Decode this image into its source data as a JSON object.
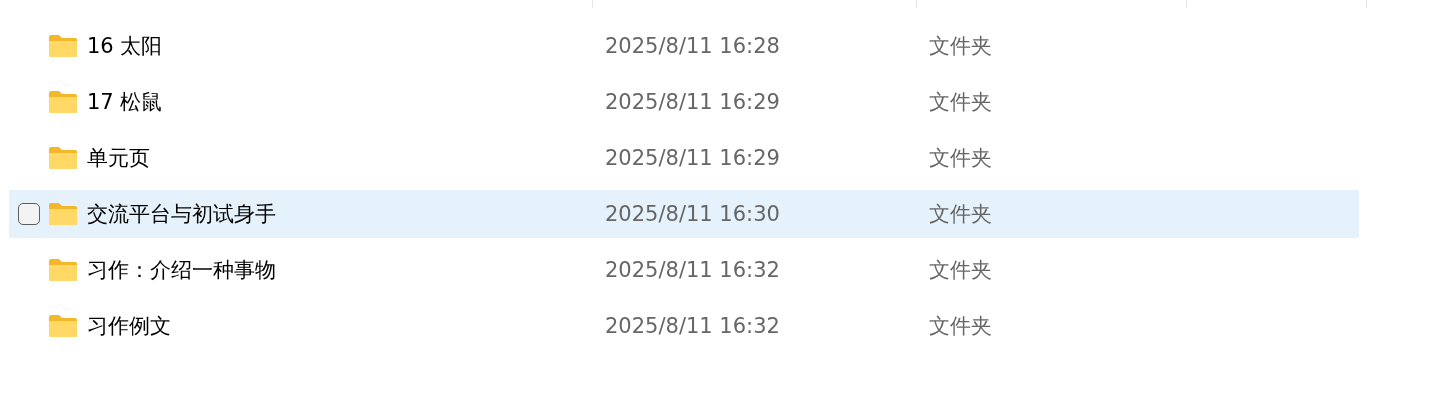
{
  "rows": [
    {
      "name": "16 太阳",
      "modified": "2025/8/11 16:28",
      "type": "文件夹",
      "hovered": false
    },
    {
      "name": "17 松鼠",
      "modified": "2025/8/11 16:29",
      "type": "文件夹",
      "hovered": false
    },
    {
      "name": "单元页",
      "modified": "2025/8/11 16:29",
      "type": "文件夹",
      "hovered": false
    },
    {
      "name": "交流平台与初试身手",
      "modified": "2025/8/11 16:30",
      "type": "文件夹",
      "hovered": true
    },
    {
      "name": "习作：介绍一种事物",
      "modified": "2025/8/11 16:32",
      "type": "文件夹",
      "hovered": false
    },
    {
      "name": "习作例文",
      "modified": "2025/8/11 16:32",
      "type": "文件夹",
      "hovered": false
    }
  ]
}
